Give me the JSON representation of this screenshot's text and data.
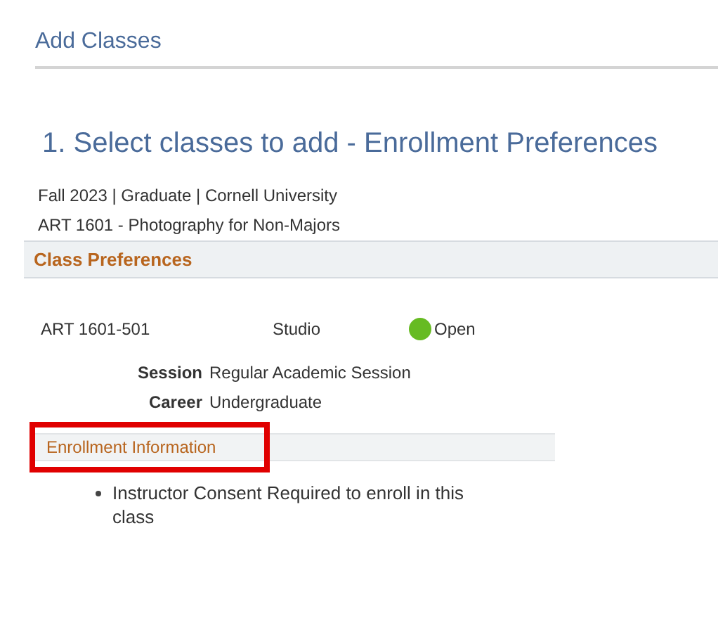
{
  "page_title": "Add Classes",
  "step_heading": "1.  Select classes to add - Enrollment Preferences",
  "term_info": "Fall 2023 | Graduate | Cornell University",
  "course_title": "ART 1601 - Photography for Non-Majors",
  "class_preferences": {
    "title": "Class Preferences",
    "section": {
      "class_number": "ART 1601-501",
      "component": "Studio",
      "status": "Open",
      "color": "#66bb22"
    },
    "details": [
      {
        "label": "Session",
        "value": "Regular Academic Session"
      },
      {
        "label": "Career",
        "value": "Undergraduate"
      }
    ]
  },
  "enrollment_information": {
    "title": "Enrollment Information",
    "highlighted": true,
    "notes": [
      "Instructor Consent Required to enroll in this class"
    ]
  }
}
